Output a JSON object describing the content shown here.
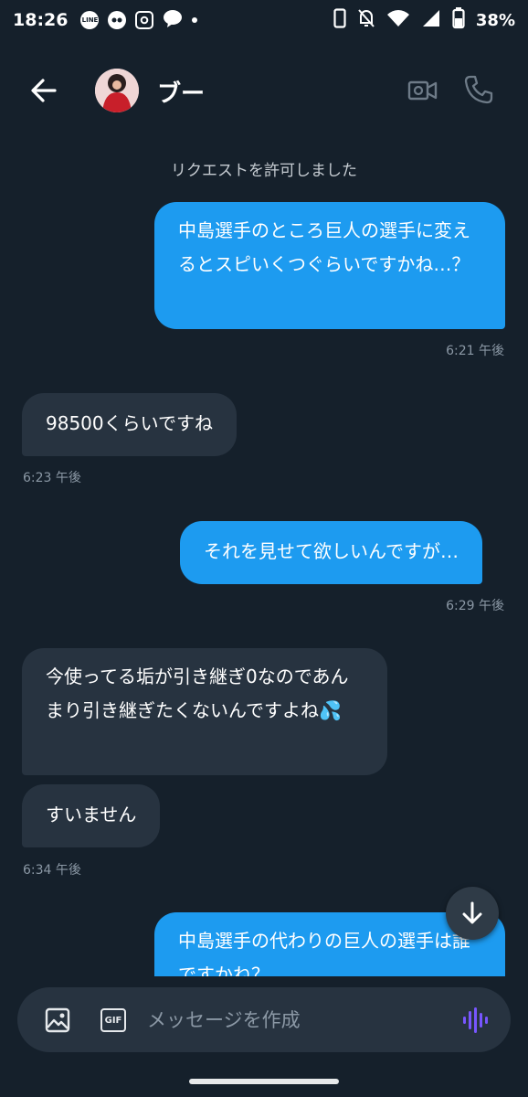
{
  "status_bar": {
    "time": "18:26",
    "app_icons": [
      "line-icon",
      "messenger-face-icon",
      "instagram-icon",
      "chat-bubble-icon"
    ],
    "right_icons": [
      "phone-icon",
      "mute-icon",
      "wifi-icon",
      "signal-icon",
      "battery-icon"
    ],
    "battery_percent": "38%"
  },
  "header": {
    "contact_name": "ブー"
  },
  "messages": {
    "system": "リクエストを許可しました",
    "m1": {
      "text": "中島選手のところ巨人の選手に変えるとスピいくつぐらいですかね…？",
      "time": "6:21 午後",
      "direction": "out"
    },
    "m2": {
      "text": "98500くらいですね",
      "time": "6:23 午後",
      "direction": "in"
    },
    "m3": {
      "text": "それを見せて欲しいんですが…",
      "time": "6:29 午後",
      "direction": "out"
    },
    "m4": {
      "text": "今使ってる垢が引き継ぎ0なのであんまり引き継ぎたくないんですよね💦",
      "direction": "in"
    },
    "m5": {
      "text": "すいません",
      "time": "6:34 午後",
      "direction": "in"
    },
    "m6": {
      "text": "中島選手の代わりの巨人の選手は誰ですかね？",
      "direction": "out"
    }
  },
  "composer": {
    "placeholder": "メッセージを作成",
    "gif_label": "GIF"
  },
  "colors": {
    "background": "#15202b",
    "outgoing_bubble": "#1d9bf0",
    "incoming_bubble": "#273340",
    "timestamp": "#8b98a5",
    "voice_accent": "#7856ff"
  }
}
